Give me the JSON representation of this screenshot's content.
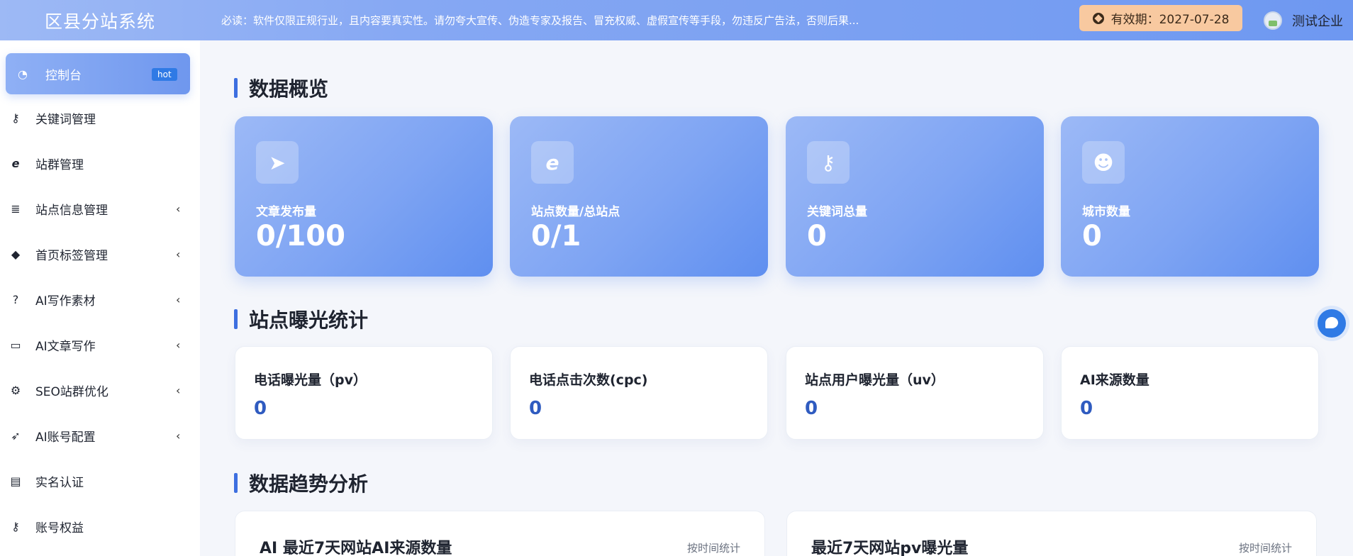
{
  "header": {
    "brand": "区县分站系统",
    "notice": "必读：软件仅限正规行业，且内容要真实性。请勿夸大宣传、伪造专家及报告、冒充权威、虚假宣传等手段，勿违反广告法，否则后果...",
    "expiry": "有效期：2027-07-28",
    "user_name": "测试企业"
  },
  "sidebar": {
    "items": [
      {
        "label": "控制台",
        "icon": "dashboard-icon",
        "badge": "hot"
      },
      {
        "label": "关键词管理",
        "icon": "key-icon"
      },
      {
        "label": "站群管理",
        "icon": "ie-icon"
      },
      {
        "label": "站点信息管理",
        "icon": "stack-icon",
        "chevron": "‹"
      },
      {
        "label": "首页标签管理",
        "icon": "tags-icon",
        "chevron": "‹"
      },
      {
        "label": "AI写作素材",
        "icon": "question-icon",
        "chevron": "‹"
      },
      {
        "label": "AI文章写作",
        "icon": "folder-icon",
        "chevron": "‹"
      },
      {
        "label": "SEO站群优化",
        "icon": "gears-icon",
        "chevron": "‹"
      },
      {
        "label": "AI账号配置",
        "icon": "rocket-icon",
        "chevron": "‹"
      },
      {
        "label": "实名认证",
        "icon": "id-card-icon"
      },
      {
        "label": "账号权益",
        "icon": "key-icon"
      }
    ]
  },
  "overview": {
    "title": "数据概览",
    "cards": [
      {
        "label": "文章发布量",
        "value": "0/100",
        "icon": "paper-plane-icon"
      },
      {
        "label": "站点数量/总站点",
        "value": "0/1",
        "icon": "ie-icon"
      },
      {
        "label": "关键词总量",
        "value": "0",
        "icon": "key-icon"
      },
      {
        "label": "城市数量",
        "value": "0",
        "icon": "users-icon"
      }
    ]
  },
  "exposure": {
    "title": "站点曝光统计",
    "cards": [
      {
        "label": "电话曝光量（pv）",
        "value": "0"
      },
      {
        "label": "电话点击次数(cpc)",
        "value": "0"
      },
      {
        "label": "站点用户曝光量（uv）",
        "value": "0"
      },
      {
        "label": "AI来源数量",
        "value": "0"
      }
    ]
  },
  "trend": {
    "title": "数据趋势分析",
    "cards": [
      {
        "title": "AI 最近7天网站AI来源数量",
        "sub": "按时间统计"
      },
      {
        "title": "最近7天网站pv曝光量",
        "sub": "按时间统计"
      }
    ]
  }
}
